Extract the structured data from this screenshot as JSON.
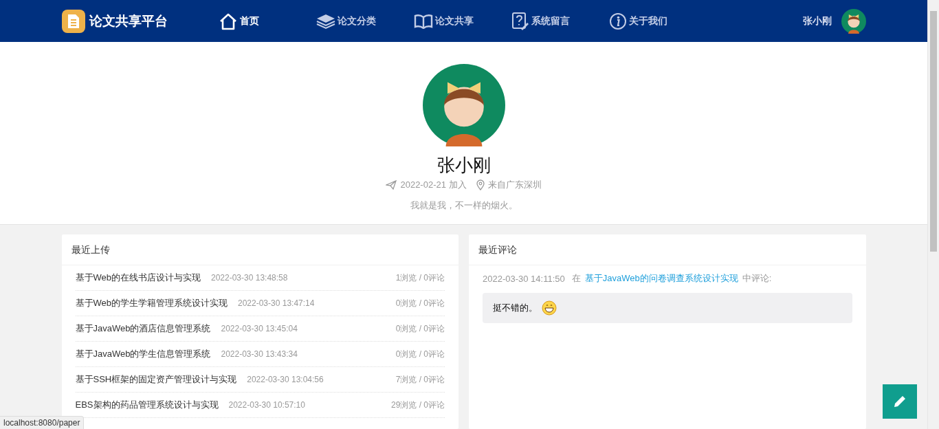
{
  "site": {
    "title": "论文共享平台"
  },
  "nav": {
    "items": [
      {
        "kind": "home",
        "label": "首页",
        "selected": true
      },
      {
        "kind": "layers",
        "label": "论文分类",
        "selected": false
      },
      {
        "kind": "book",
        "label": "论文共享",
        "selected": false
      },
      {
        "kind": "help",
        "label": "系统留言",
        "selected": false
      },
      {
        "kind": "info",
        "label": "关于我们",
        "selected": false
      }
    ]
  },
  "user": {
    "name": "张小刚"
  },
  "profile": {
    "name": "张小刚",
    "joined": "2022-02-21 加入",
    "location": "来自广东深圳",
    "bio": "我就是我，不一样的烟火。"
  },
  "uploads": {
    "title": "最近上传",
    "rows": [
      {
        "title": "基于Web的在线书店设计与实现",
        "time": "2022-03-30 13:48:58",
        "stats": "1浏览 / 0评论"
      },
      {
        "title": "基于Web的学生学籍管理系统设计实现",
        "time": "2022-03-30 13:47:14",
        "stats": "0浏览 / 0评论"
      },
      {
        "title": "基于JavaWeb的酒店信息管理系统",
        "time": "2022-03-30 13:45:04",
        "stats": "0浏览 / 0评论"
      },
      {
        "title": "基于JavaWeb的学生信息管理系统",
        "time": "2022-03-30 13:43:34",
        "stats": "0浏览 / 0评论"
      },
      {
        "title": "基于SSH框架的固定资产管理设计与实现",
        "time": "2022-03-30 13:04:56",
        "stats": "7浏览 / 0评论"
      },
      {
        "title": "EBS架构的药品管理系统设计与实现",
        "time": "2022-03-30 10:57:10",
        "stats": "29浏览 / 0评论"
      }
    ]
  },
  "comments": {
    "title": "最近评论",
    "items": [
      {
        "time": "2022-03-30 14:11:50",
        "prefix": "在",
        "paper": "基于JavaWeb的问卷调查系统设计实现",
        "suffix": "中评论:",
        "content": "挺不错的。"
      }
    ]
  },
  "status_bar": "localhost:8080/paper"
}
